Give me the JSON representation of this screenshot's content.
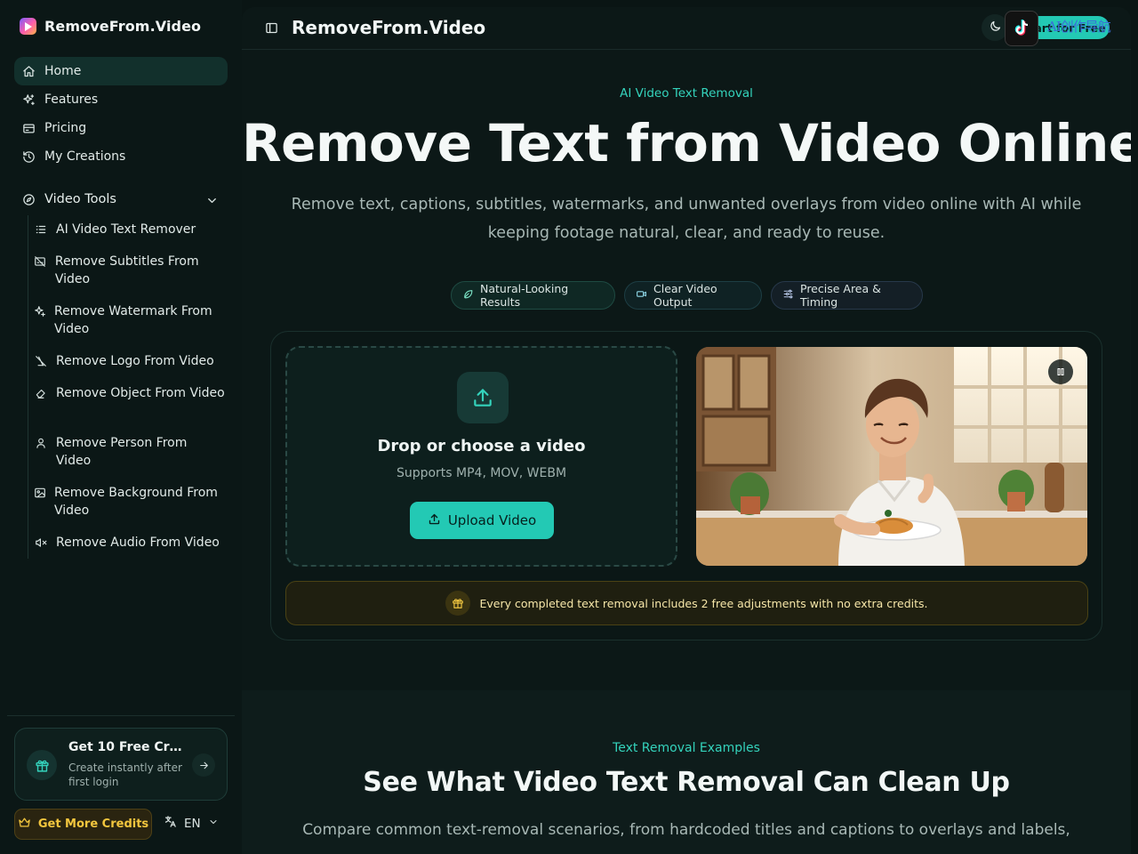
{
  "brand": {
    "name": "RemoveFrom.Video"
  },
  "nav": {
    "items": [
      {
        "label": "Home",
        "icon": "home-icon",
        "active": true
      },
      {
        "label": "Features",
        "icon": "sparkles-icon"
      },
      {
        "label": "Pricing",
        "icon": "card-icon"
      },
      {
        "label": "My Creations",
        "icon": "history-icon"
      }
    ],
    "group": {
      "label": "Video Tools",
      "icon": "compass-icon"
    },
    "tools": [
      {
        "label": "AI Video Text Remover",
        "icon": "list-icon"
      },
      {
        "label": "Remove Subtitles From Video",
        "icon": "captions-off-icon"
      },
      {
        "label": "Remove Watermark From Video",
        "icon": "sparkles-icon"
      },
      {
        "label": "Remove Logo From Video",
        "icon": "brand-off-icon"
      },
      {
        "label": "Remove Object From Video",
        "icon": "eraser-icon"
      },
      {
        "label": "Remove Person From Video",
        "icon": "user-icon"
      },
      {
        "label": "Remove Background From Video",
        "icon": "image-icon"
      },
      {
        "label": "Remove Audio From Video",
        "icon": "volume-off-icon"
      }
    ]
  },
  "promo": {
    "title": "Get 10 Free Cred...",
    "subtitle": "Create instantly after first login"
  },
  "footer": {
    "credits_label": "Get More Credits",
    "lang": "EN"
  },
  "topbar": {
    "title": "RemoveFrom.Video",
    "start_label": "Start for Free",
    "overlay_text": "AI创作导航"
  },
  "hero": {
    "kicker": "AI Video Text Removal",
    "title": "Remove Text from Video Online",
    "description": "Remove text, captions, subtitles, watermarks, and unwanted overlays from video online with AI while keeping footage natural, clear, and ready to reuse.",
    "chips": [
      "Natural-Looking Results",
      "Clear Video Output",
      "Precise Area & Timing"
    ]
  },
  "upload": {
    "title": "Drop or choose a video",
    "formats": "Supports MP4, MOV, WEBM",
    "button": "Upload Video"
  },
  "notice": "Every completed text removal includes 2 free adjustments with no extra credits.",
  "examples": {
    "kicker": "Text Removal Examples",
    "title": "See What Video Text Removal Can Clean Up",
    "description": "Compare common text-removal scenarios, from hardcoded titles and captions to overlays and labels,"
  },
  "colors": {
    "accent": "#23c9b4",
    "gold": "#f3c63e",
    "background": "#0a1514"
  }
}
